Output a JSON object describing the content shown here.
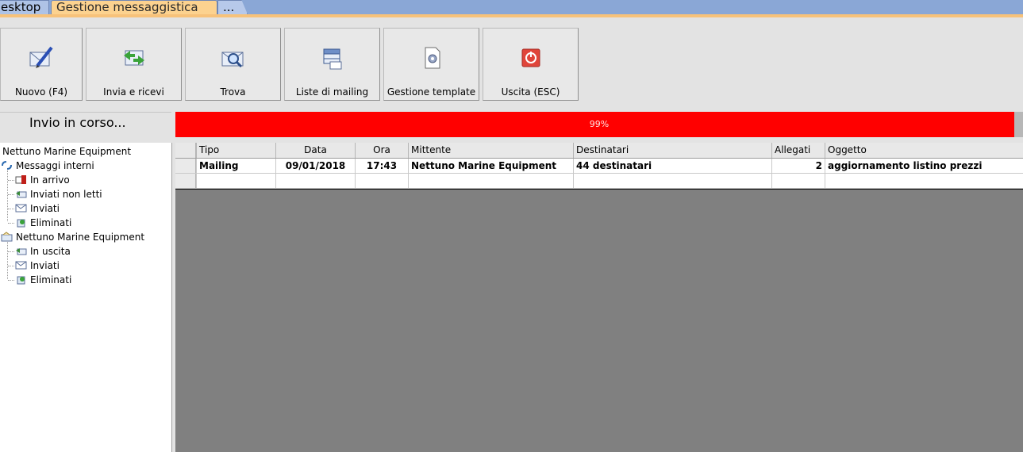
{
  "tabs": [
    {
      "label": "esktop"
    },
    {
      "label": "Gestione messaggistica"
    },
    {
      "label": "..."
    }
  ],
  "toolbar": {
    "buttons": [
      {
        "label": "Nuovo (F4)",
        "icon": "new-message-icon"
      },
      {
        "label": "Invia e ricevi",
        "icon": "send-receive-icon"
      },
      {
        "label": "Trova",
        "icon": "find-icon"
      },
      {
        "label": "Liste di mailing",
        "icon": "mailing-lists-icon"
      },
      {
        "label": "Gestione template",
        "icon": "template-icon"
      },
      {
        "label": "Uscita (ESC)",
        "icon": "exit-icon"
      }
    ]
  },
  "status": {
    "text": "Invio in corso...",
    "progress": 0.99,
    "progress_label": "99%",
    "progress_color": "#ff0000"
  },
  "tree": {
    "root": "Nettuno Marine Equipment",
    "groups": [
      {
        "label": "Messaggi interni",
        "icon": "internal-messages-icon",
        "items": [
          {
            "label": "In arrivo",
            "icon": "inbox-icon"
          },
          {
            "label": "Inviati non letti",
            "icon": "sent-unread-icon"
          },
          {
            "label": "Inviati",
            "icon": "sent-icon"
          },
          {
            "label": "Eliminati",
            "icon": "trash-icon"
          }
        ]
      },
      {
        "label": "Nettuno Marine Equipment",
        "icon": "account-folder-icon",
        "items": [
          {
            "label": "In uscita",
            "icon": "outbox-icon"
          },
          {
            "label": "Inviati",
            "icon": "sent-icon"
          },
          {
            "label": "Eliminati",
            "icon": "trash-icon"
          }
        ]
      }
    ]
  },
  "grid": {
    "columns": [
      "Tipo",
      "Data",
      "Ora",
      "Mittente",
      "Destinatari",
      "Allegati",
      "Oggetto"
    ],
    "rows": [
      [
        "Mailing",
        "09/01/2018",
        "17:43",
        "Nettuno Marine Equipment",
        "44 destinatari",
        "2",
        "aggiornamento listino prezzi"
      ],
      [
        "",
        "",
        "",
        "",
        "",
        "",
        ""
      ]
    ]
  }
}
